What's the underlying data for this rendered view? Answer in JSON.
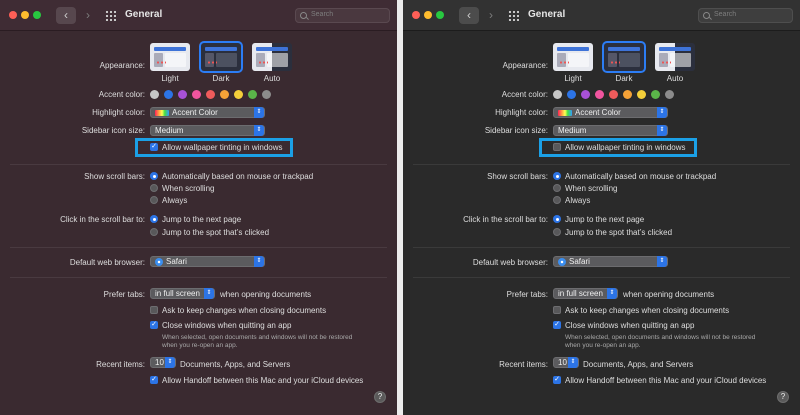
{
  "window": {
    "title": "General",
    "search_placeholder": "Search",
    "back_glyph": "‹",
    "forward_glyph": "›"
  },
  "labels": {
    "appearance": "Appearance:",
    "accent": "Accent color:",
    "highlight": "Highlight color:",
    "sidebar_size": "Sidebar icon size:",
    "scroll_bars": "Show scroll bars:",
    "click_scroll": "Click in the scroll bar to:",
    "browser": "Default web browser:",
    "prefer_tabs": "Prefer tabs:",
    "recent_items": "Recent items:"
  },
  "appearance_options": [
    "Light",
    "Dark",
    "Auto"
  ],
  "accent_colors": [
    "#c6c6c6",
    "#2c74e6",
    "#a851d6",
    "#f0559f",
    "#ef5b5b",
    "#f5a237",
    "#f4cf3a",
    "#5ab549",
    "#8c8c8c"
  ],
  "highlight_value": "Accent Color",
  "sidebar_value": "Medium",
  "wallpaper_tinting": "Allow wallpaper tinting in windows",
  "scroll_options": [
    "Automatically based on mouse or trackpad",
    "When scrolling",
    "Always"
  ],
  "click_options": [
    "Jump to the next page",
    "Jump to the spot that’s clicked"
  ],
  "browser_value": "Safari",
  "tabs_value": "in full screen",
  "tabs_suffix": "when opening documents",
  "ask_keep": "Ask to keep changes when closing documents",
  "close_windows": "Close windows when quitting an app",
  "close_note": "When selected, open documents and windows will not be restored when you re-open an app.",
  "recent_value": "10",
  "recent_suffix": "Documents, Apps, and Servers",
  "handoff": "Allow Handoff between this Mac and your iCloud devices",
  "help_glyph": "?",
  "check_glyph": "✓",
  "popup_arrow": "⌃⌄",
  "colors": {
    "left_bg": "#3a2a30",
    "right_bg": "#2a2a2a",
    "accent_blue": "#2c74e6",
    "highlight_box": "#1ba0e6"
  },
  "states": {
    "left_wallpaper_tinting": true,
    "right_wallpaper_tinting": false,
    "ask_keep": false,
    "close_windows": true,
    "handoff": true
  }
}
